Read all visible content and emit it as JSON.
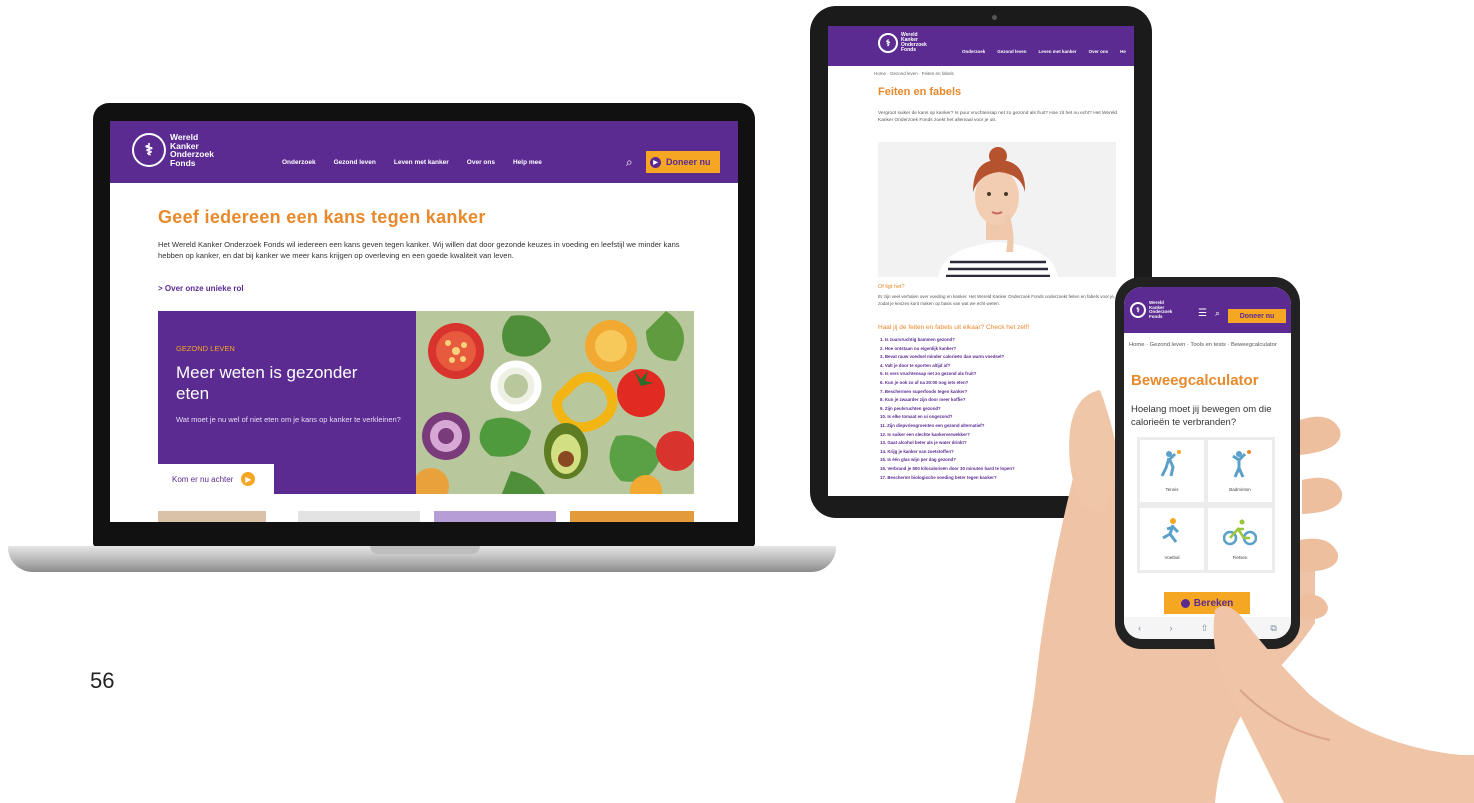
{
  "page_number": "56",
  "brand": {
    "org_name_lines": [
      "Wereld",
      "Kanker",
      "Onderzoek",
      "Fonds"
    ],
    "purple": "#5b2b92",
    "orange": "#e8892b",
    "yellow": "#f5a623",
    "logo_icon": "wkof-logo-icon"
  },
  "laptop": {
    "nav": [
      "Onderzoek",
      "Gezond leven",
      "Leven met kanker",
      "Over ons",
      "Help mee"
    ],
    "search_icon": "search-icon",
    "donate_label": "Doneer nu",
    "title": "Geef iedereen een kans tegen kanker",
    "intro": "Het Wereld Kanker Onderzoek Fonds wil iedereen een kans geven tegen kanker. Wij willen dat door gezonde keuzes in voeding en leefstijl we minder kans hebben op kanker, en dat bij kanker we meer kans krijgen op overleving en een goede kwaliteit van leven.",
    "intro_link": "> Over onze unieke rol",
    "card": {
      "eyebrow": "GEZOND LEVEN",
      "headline": "Meer weten is gezonder eten",
      "description": "Wat moet je nu wel of niet eten om je kans op kanker te verkleinen?",
      "cta": "Kom er nu achter"
    }
  },
  "tablet": {
    "nav": [
      "Onderzoek",
      "Gezond leven",
      "Leven met kanker",
      "Over ons",
      "He"
    ],
    "breadcrumb": "Home · Gezond leven · Feiten en fabels",
    "title": "Feiten en fabels",
    "intro": "Vergroot suiker de kans op kanker? Is puur vruchtensap net zo gezond als fruit? Hoe zit het nu echt? Het Wereld Kanker Onderzoek Fonds zoekt het allemaal voor je uit.",
    "subheading": "Of ligt het?",
    "paragraph": "Er zijn veel verhalen over voeding en kanker. Het Wereld Kanker Onderzoek Fonds onderzoekt feiten en fabels voor je, zodat je keuzes kunt maken op basis van wat we echt weten.",
    "question_heading": "Haal jij de feiten en fabels uit elkaar? Check het zelf!",
    "questions": [
      "1. Is zuurvruchtig bammen gezond?",
      "2. Hoe ontstaan nu eigenlijk kanker?",
      "3. Bevat rauw voedsel minder calorieën dan warm voedsel?",
      "4. Valt je door te sporten altijd af?",
      "5. Is vers vruchtensap net zo gezond als fruit?",
      "6. Kun je ook zo af na 20:00 nog iets eten?",
      "7. Beschermen superfoods tegen kanker?",
      "8. Kun je zwaarder zijn door meer koffie?",
      "9. Zijn peulvruchten gezond?",
      "10. Is elke tomaat en ui ongezond?",
      "11. Zijn diepvriesgroenten een gezond alternatief?",
      "12. Is suiker een slechte kankerverwekker?",
      "13. Gaat alcohol beter als je water drinkt?",
      "14. Krijg je kanker van zoetstoffen?",
      "15. Is één glas wijn per dag gezond?",
      "16. Verbrand je 500 kilocalorieën door 30 minuten hard te lopen?",
      "17. Beschermt biologische voeding beter tegen kanker?"
    ]
  },
  "phone": {
    "menu_icon": "hamburger-menu-icon",
    "search_icon": "search-icon",
    "donate_label": "Doneer nu",
    "breadcrumb": "Home · Gezond leven · Tools en tests · Beweegcalculator",
    "title": "Beweegcalculator",
    "question": "Hoelang moet jij bewegen om die calorieën te verbranden?",
    "activities": [
      {
        "label": "Tennis",
        "icon": "tennis-player-icon"
      },
      {
        "label": "Badminton",
        "icon": "badminton-player-icon"
      },
      {
        "label": "Voetbal",
        "icon": "runner-icon"
      },
      {
        "label": "Fietsen",
        "icon": "cyclist-icon"
      }
    ],
    "calc_button": "Bereken",
    "browser_icons": [
      "back-arrow-icon",
      "forward-arrow-icon",
      "share-icon",
      "bookmarks-icon",
      "tabs-icon"
    ]
  }
}
